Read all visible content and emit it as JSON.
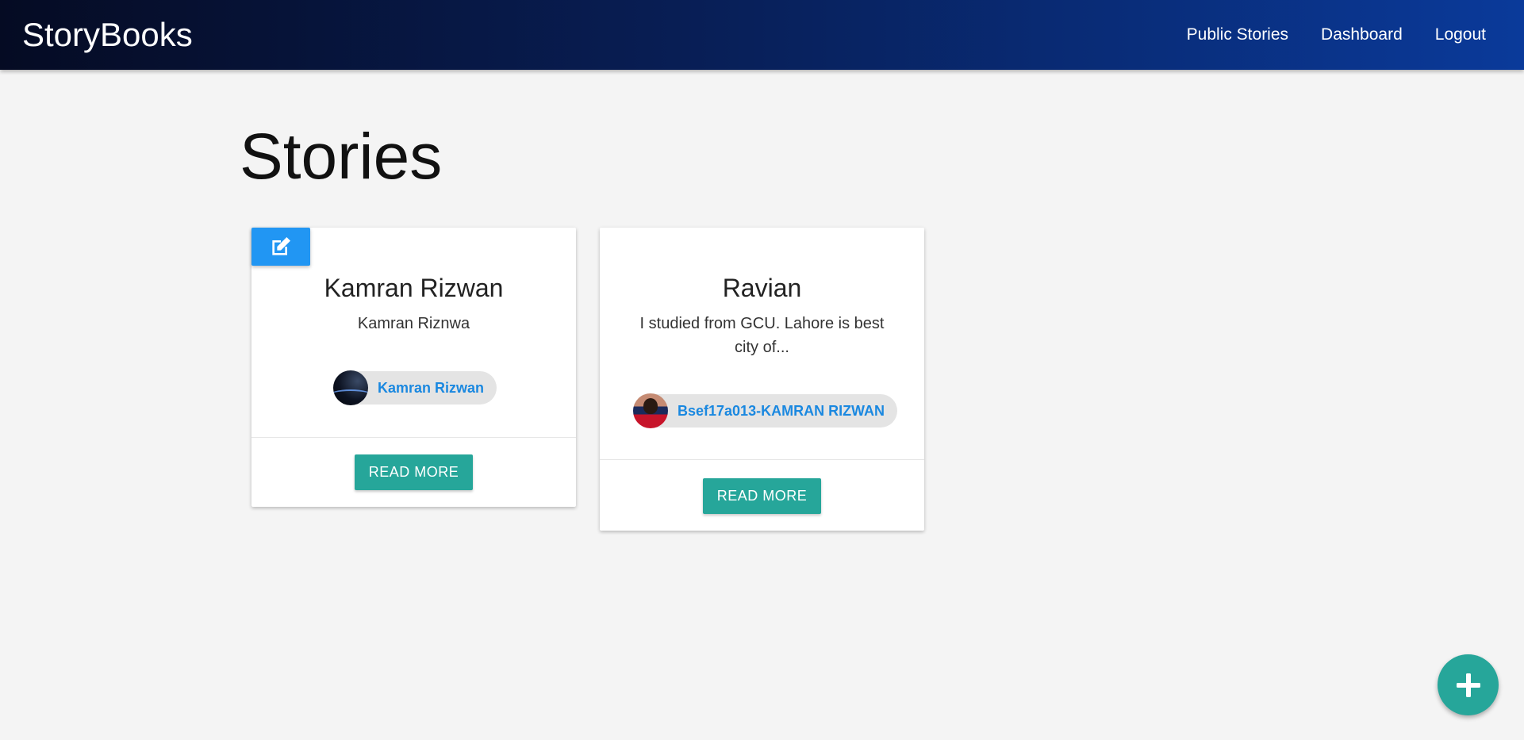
{
  "app": {
    "brand": "StoryBooks"
  },
  "nav": {
    "links": [
      {
        "label": "Public Stories"
      },
      {
        "label": "Dashboard"
      },
      {
        "label": "Logout"
      }
    ]
  },
  "page": {
    "title": "Stories"
  },
  "stories": [
    {
      "title": "Kamran Rizwan",
      "excerpt": "Kamran Riznwa",
      "author": "Kamran Rizwan",
      "avatar_icon": "avatar-space",
      "editable": true,
      "action_label": "READ MORE"
    },
    {
      "title": "Ravian",
      "excerpt": "I studied from GCU. Lahore is best city of...",
      "author": "Bsef17a013-KAMRAN RIZWAN",
      "avatar_icon": "avatar-person",
      "editable": false,
      "action_label": "READ MORE"
    }
  ],
  "icons": {
    "edit": "edit-icon",
    "add": "plus-icon"
  },
  "colors": {
    "nav_gradient_start": "#050b23",
    "nav_gradient_end": "#0a3a9a",
    "accent_teal": "#26a69a",
    "edit_blue": "#2196f3",
    "chip_link": "#1a88e0"
  }
}
